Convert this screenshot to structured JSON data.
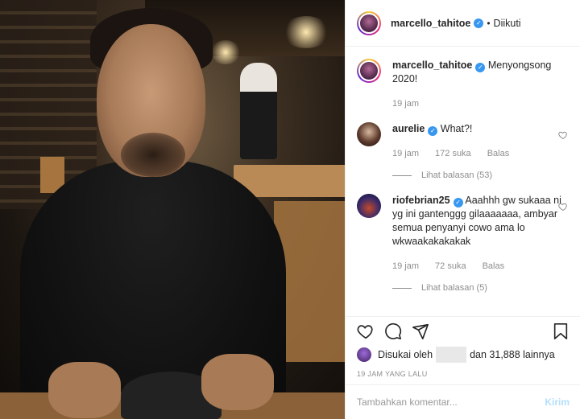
{
  "header": {
    "username": "marcello_tahitoe",
    "separator": "•",
    "follow_status": "Diikuti"
  },
  "caption": {
    "username": "marcello_tahitoe",
    "text": "Menyongsong 2020!",
    "time": "19 jam"
  },
  "comments": [
    {
      "username": "aurelie",
      "verified": true,
      "text": "What?!",
      "time": "19 jam",
      "likes": "172 suka",
      "reply": "Balas",
      "view_replies": "Lihat balasan (53)"
    },
    {
      "username": "riofebrian25",
      "verified": true,
      "text": "Aaahhh gw sukaaa ni yg ini gantenggg gilaaaaaaa, ambyar semua penyanyi cowo ama lo wkwaakakakakak",
      "time": "19 jam",
      "likes": "72 suka",
      "reply": "Balas",
      "view_replies": "Lihat balasan (5)"
    }
  ],
  "likes": {
    "prefix": "Disukai oleh",
    "suffix": "dan 31,888 lainnya"
  },
  "post_time": "19 JAM YANG LALU",
  "composer": {
    "placeholder": "Tambahkan komentar...",
    "post_label": "Kirim"
  },
  "colors": {
    "verified": "#3897f0",
    "muted": "#8e8e8e",
    "post_disabled": "#b2dffc"
  },
  "icons": [
    "heart-icon",
    "comment-icon",
    "share-icon",
    "bookmark-icon"
  ]
}
